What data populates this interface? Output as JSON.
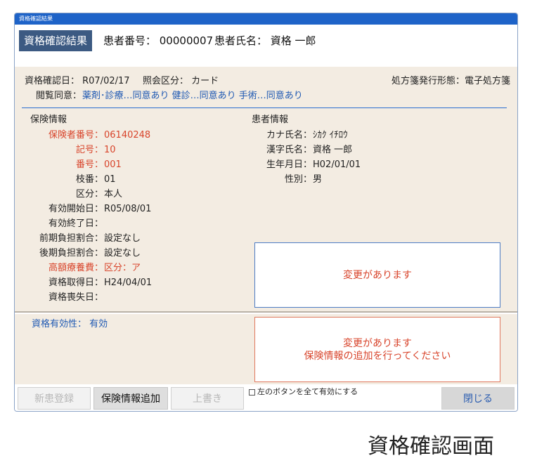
{
  "window": {
    "title": "資格確認結果"
  },
  "header": {
    "badge": "資格確認結果",
    "patient_number": "患者番号： 00000007",
    "patient_name": "患者氏名： 資格 一郎"
  },
  "summary": {
    "check_date": "資格確認日： R07/02/17",
    "inquiry_type": "照会区分： カード",
    "prescription_format": "処方箋発行形態：電子処方箋",
    "consent_label": "閲覧同意：",
    "consent_values": "薬剤･診療…同意あり 健診…同意あり 手術…同意あり"
  },
  "insurance": {
    "heading": "保険情報",
    "rows": [
      {
        "label": "保険者番号：",
        "value": "06140248",
        "highlight": true
      },
      {
        "label": "記号：",
        "value": "10",
        "highlight": true
      },
      {
        "label": "番号：",
        "value": "001",
        "highlight": true
      },
      {
        "label": "枝番：",
        "value": "01",
        "highlight": false
      },
      {
        "label": "区分：",
        "value": "本人",
        "highlight": false
      },
      {
        "label": "有効開始日：",
        "value": "R05/08/01",
        "highlight": false
      },
      {
        "label": "有効終了日：",
        "value": "",
        "highlight": false
      },
      {
        "label": "前期負担割合：",
        "value": "設定なし",
        "highlight": false
      },
      {
        "label": "後期負担割合：",
        "value": "設定なし",
        "highlight": false
      },
      {
        "label": "高額療養費：",
        "value": "区分：ア",
        "highlight": true
      },
      {
        "label": "資格取得日：",
        "value": "H24/04/01",
        "highlight": false
      },
      {
        "label": "資格喪失日：",
        "value": "",
        "highlight": false
      }
    ]
  },
  "patient": {
    "heading": "患者情報",
    "rows": [
      {
        "label": "カナ氏名：",
        "value": "ｼｶｸ ｲﾁﾛｳ"
      },
      {
        "label": "漢字氏名：",
        "value": "資格 一郎"
      },
      {
        "label": "生年月日：",
        "value": "H02/01/01"
      },
      {
        "label": "性別：",
        "value": "男"
      }
    ]
  },
  "notices": {
    "change_1": "変更があります",
    "change_2_line1": "変更があります",
    "change_2_line2": "保険情報の追加を行ってください"
  },
  "validity": {
    "label": "資格有効性： 有効"
  },
  "footer": {
    "new_patient": "新患登録",
    "add_insurance": "保険情報追加",
    "overwrite": "上書き",
    "enable_all": "左のボタンを全て有効にする",
    "close": "閉じる"
  },
  "caption": "資格確認画面",
  "colors": {
    "accent": "#1f59b3",
    "warning": "#d8442b",
    "panel": "#f3ece2",
    "badge": "#3c5a82"
  }
}
